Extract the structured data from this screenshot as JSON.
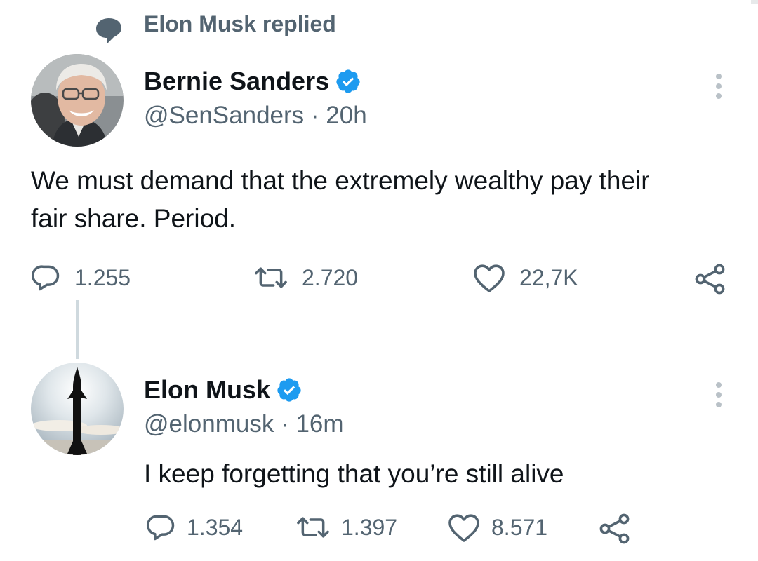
{
  "context": {
    "text": "Elon Musk replied",
    "icon": "speech-bubble-icon"
  },
  "colors": {
    "text_primary": "#0f1419",
    "text_secondary": "#536471",
    "verified_blue": "#1d9bf0",
    "thread_line": "#cfd9de"
  },
  "tweets": [
    {
      "author": {
        "name": "Bernie Sanders",
        "handle": "@SenSanders",
        "separator": "·",
        "time": "20h",
        "verified": true,
        "avatar": "bernie-sanders-avatar"
      },
      "text_lines": [
        "We must demand that the extremely wealthy pay their",
        "fair share. Period."
      ],
      "stats": {
        "replies": "1.255",
        "retweets": "2.720",
        "likes": "22,7K"
      }
    },
    {
      "author": {
        "name": "Elon Musk",
        "handle": "@elonmusk",
        "separator": "·",
        "time": "16m",
        "verified": true,
        "avatar": "starship-rocket-avatar"
      },
      "text_lines": [
        "I keep forgetting that you’re still alive"
      ],
      "stats": {
        "replies": "1.354",
        "retweets": "1.397",
        "likes": "8.571"
      }
    }
  ]
}
